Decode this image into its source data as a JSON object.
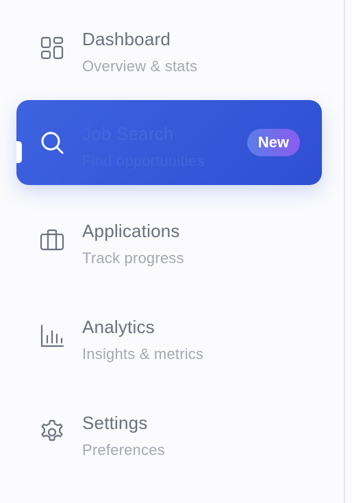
{
  "nav": {
    "items": [
      {
        "label": "Dashboard",
        "subtitle": "Overview & stats",
        "icon": "dashboard-grid-icon"
      },
      {
        "label": "Job Search",
        "subtitle": "Find opportunities",
        "icon": "search-icon",
        "active": true,
        "badge": "New"
      },
      {
        "label": "Applications",
        "subtitle": "Track progress",
        "icon": "briefcase-icon"
      },
      {
        "label": "Analytics",
        "subtitle": "Insights & metrics",
        "icon": "bar-chart-icon"
      },
      {
        "label": "Settings",
        "subtitle": "Preferences",
        "icon": "gear-icon"
      }
    ]
  },
  "colors": {
    "active_bg": "#3d63e0",
    "text": "#6b7080",
    "subtext": "#a4a8b3",
    "badge_gradient_start": "#5b7de8",
    "badge_gradient_end": "#8a5cf0"
  }
}
